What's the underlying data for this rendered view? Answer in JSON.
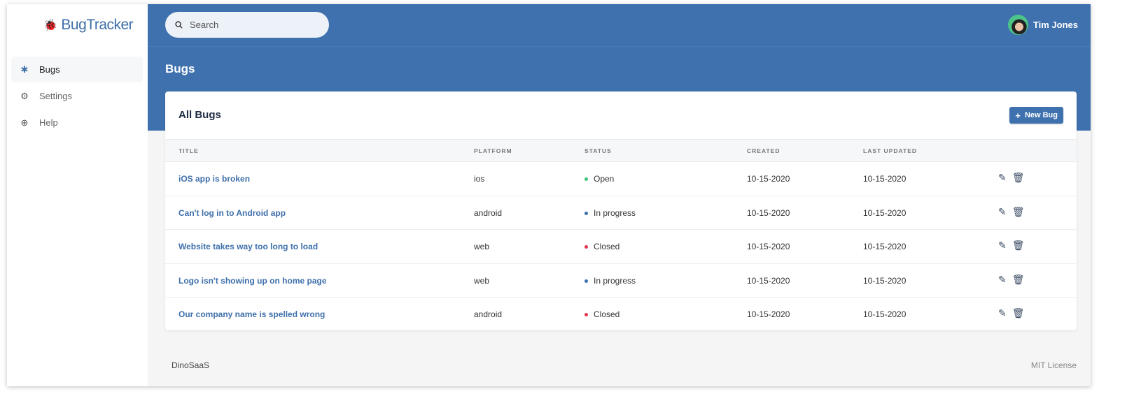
{
  "app": {
    "name": "BugTracker"
  },
  "sidebar": {
    "items": [
      {
        "label": "Bugs",
        "icon": "bug-icon",
        "active": true
      },
      {
        "label": "Settings",
        "icon": "gear-icon"
      },
      {
        "label": "Help",
        "icon": "lifebuoy-icon"
      }
    ]
  },
  "search": {
    "placeholder": "Search"
  },
  "user": {
    "name": "Tim Jones"
  },
  "page": {
    "title": "Bugs"
  },
  "card": {
    "title": "All Bugs",
    "new_button": "New Bug"
  },
  "table": {
    "headers": [
      "TITLE",
      "PLATFORM",
      "STATUS",
      "CREATED",
      "LAST UPDATED"
    ],
    "rows": [
      {
        "title": "iOS app is broken",
        "platform": "ios",
        "status": "Open",
        "created": "10-15-2020",
        "updated": "10-15-2020"
      },
      {
        "title": "Can't log in to Android app",
        "platform": "android",
        "status": "In progress",
        "created": "10-15-2020",
        "updated": "10-15-2020"
      },
      {
        "title": "Website takes way too long to load",
        "platform": "web",
        "status": "Closed",
        "created": "10-15-2020",
        "updated": "10-15-2020"
      },
      {
        "title": "Logo isn't showing up on home page",
        "platform": "web",
        "status": "In progress",
        "created": "10-15-2020",
        "updated": "10-15-2020"
      },
      {
        "title": "Our company name is spelled wrong",
        "platform": "android",
        "status": "Closed",
        "created": "10-15-2020",
        "updated": "10-15-2020"
      }
    ]
  },
  "status_colors": {
    "Open": "#3cc47c",
    "In progress": "#3e71ae",
    "Closed": "#e5354f"
  },
  "footer": {
    "left": "DinoSaaS",
    "right": "MIT License"
  }
}
